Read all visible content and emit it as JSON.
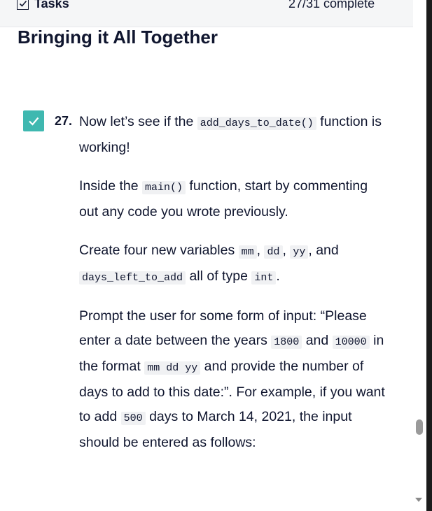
{
  "header": {
    "tasks_label": "Tasks",
    "progress_text": "27/31 complete"
  },
  "section": {
    "title": "Bringing it All Together"
  },
  "step": {
    "number": "27.",
    "checked": true,
    "p1": {
      "t1": "Now let’s see if the ",
      "c1": "add_days_to_date()",
      "t2": " function is working!"
    },
    "p2": {
      "t1": "Inside the ",
      "c1": "main()",
      "t2": " function, start by commenting out any code you wrote previously."
    },
    "p3": {
      "t1": "Create four new variables ",
      "c1": "mm",
      "t2": ", ",
      "c2": "dd",
      "t3": ", ",
      "c3": "yy",
      "t4": ", and ",
      "c4": "days_left_to_add",
      "t5": " all of type ",
      "c5": "int",
      "t6": "."
    },
    "p4": {
      "t1": "Prompt the user for some form of input: “Please enter a date between the years ",
      "c1": "1800",
      "t2": " and ",
      "c2": "10000",
      "t3": " in the format ",
      "c3": "mm dd yy",
      "t4": " and provide the number of days to add to this date:”. For example, if you want to add ",
      "c4": "500",
      "t5": " days to March 14, 2021, the input should be entered as follows:"
    }
  },
  "colors": {
    "accent": "#3fb8b0",
    "text": "#10162f",
    "code_bg": "#f0f1f3"
  },
  "icons": {
    "tasks": "checkbox-icon",
    "step": "checkmark-icon"
  }
}
